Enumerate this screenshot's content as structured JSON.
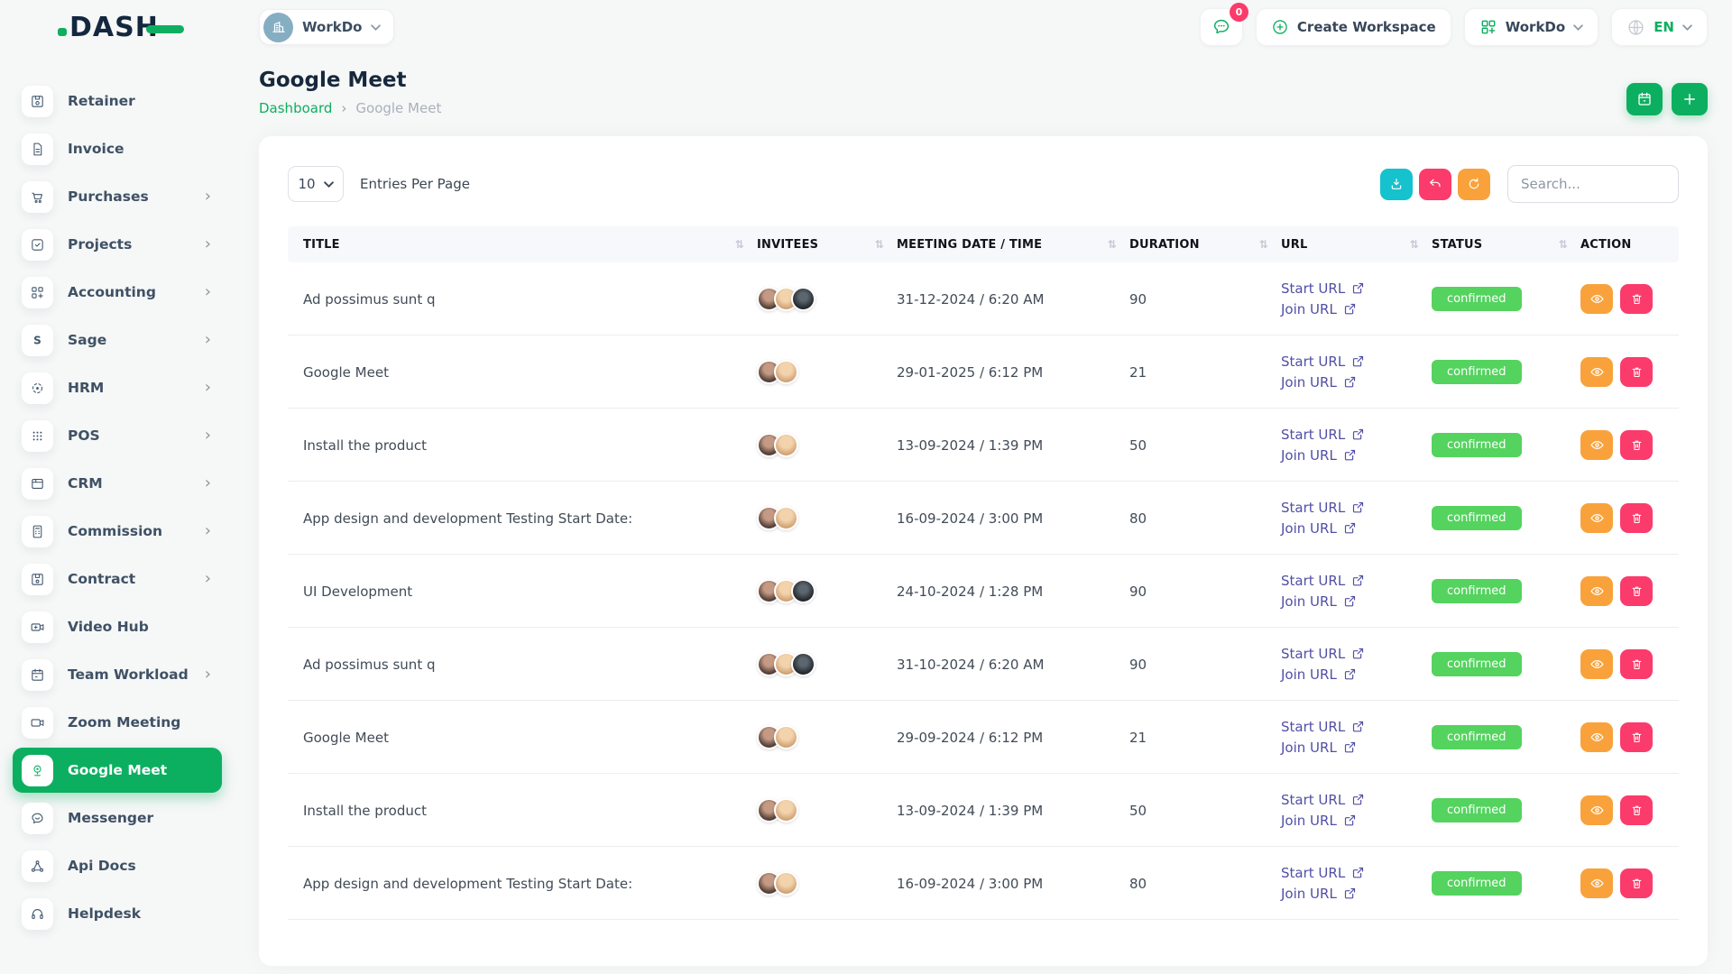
{
  "colors": {
    "theme_green": "#0caf60",
    "badge_green": "#54d35f",
    "teal": "#16c2cd",
    "pink": "#fb3b6b",
    "orange": "#f9a23b",
    "link_indigo": "#514fa5",
    "navy": "#16283c"
  },
  "topbar": {
    "logo_text": "DASH",
    "workspace_switcher_label": "WorkDo",
    "messages_badge_count": "0",
    "create_workspace_label": "Create Workspace",
    "workspace_menu_label": "WorkDo",
    "language_code": "EN"
  },
  "sidebar": {
    "items": [
      {
        "label": "Retainer",
        "icon": "retainer",
        "expandable": false,
        "active": false
      },
      {
        "label": "Invoice",
        "icon": "invoice",
        "expandable": false,
        "active": false
      },
      {
        "label": "Purchases",
        "icon": "purchases",
        "expandable": true,
        "active": false
      },
      {
        "label": "Projects",
        "icon": "projects",
        "expandable": true,
        "active": false
      },
      {
        "label": "Accounting",
        "icon": "accounting",
        "expandable": true,
        "active": false
      },
      {
        "label": "Sage",
        "icon": "sage",
        "expandable": true,
        "active": false
      },
      {
        "label": "HRM",
        "icon": "hrm",
        "expandable": true,
        "active": false
      },
      {
        "label": "POS",
        "icon": "pos",
        "expandable": true,
        "active": false
      },
      {
        "label": "CRM",
        "icon": "crm",
        "expandable": true,
        "active": false
      },
      {
        "label": "Commission",
        "icon": "commission",
        "expandable": true,
        "active": false
      },
      {
        "label": "Contract",
        "icon": "contract",
        "expandable": true,
        "active": false
      },
      {
        "label": "Video Hub",
        "icon": "video-hub",
        "expandable": false,
        "active": false
      },
      {
        "label": "Team Workload",
        "icon": "team-workload",
        "expandable": true,
        "active": false
      },
      {
        "label": "Zoom Meeting",
        "icon": "zoom-meeting",
        "expandable": false,
        "active": false
      },
      {
        "label": "Google Meet",
        "icon": "google-meet",
        "expandable": false,
        "active": true
      },
      {
        "label": "Messenger",
        "icon": "messenger",
        "expandable": false,
        "active": false
      },
      {
        "label": "Api Docs",
        "icon": "api-docs",
        "expandable": false,
        "active": false
      },
      {
        "label": "Helpdesk",
        "icon": "helpdesk",
        "expandable": false,
        "active": false
      }
    ]
  },
  "page": {
    "title": "Google Meet",
    "breadcrumb_root": "Dashboard",
    "breadcrumb_current": "Google Meet"
  },
  "toolbar": {
    "entries_per_page_value": "10",
    "entries_per_page_label": "Entries Per Page",
    "search_placeholder": "Search..."
  },
  "table": {
    "columns": [
      "TITLE",
      "INVITEES",
      "MEETING DATE / TIME",
      "DURATION",
      "URL",
      "STATUS",
      "ACTION"
    ],
    "link_labels": {
      "start": "Start URL",
      "join": "Join URL"
    },
    "rows": [
      {
        "title": "Ad possimus sunt q",
        "invitees_count": 3,
        "datetime": "31-12-2024 / 6:20 AM",
        "duration": "90",
        "status": "confirmed"
      },
      {
        "title": "Google Meet",
        "invitees_count": 2,
        "datetime": "29-01-2025 / 6:12 PM",
        "duration": "21",
        "status": "confirmed"
      },
      {
        "title": "Install the product",
        "invitees_count": 2,
        "datetime": "13-09-2024 / 1:39 PM",
        "duration": "50",
        "status": "confirmed"
      },
      {
        "title": "App design and development Testing Start Date:",
        "invitees_count": 2,
        "datetime": "16-09-2024 / 3:00 PM",
        "duration": "80",
        "status": "confirmed"
      },
      {
        "title": "UI Development",
        "invitees_count": 3,
        "datetime": "24-10-2024 / 1:28 PM",
        "duration": "90",
        "status": "confirmed"
      },
      {
        "title": "Ad possimus sunt q",
        "invitees_count": 3,
        "datetime": "31-10-2024 / 6:20 AM",
        "duration": "90",
        "status": "confirmed"
      },
      {
        "title": "Google Meet",
        "invitees_count": 2,
        "datetime": "29-09-2024 / 6:12 PM",
        "duration": "21",
        "status": "confirmed"
      },
      {
        "title": "Install the product",
        "invitees_count": 2,
        "datetime": "13-09-2024 / 1:39 PM",
        "duration": "50",
        "status": "confirmed"
      },
      {
        "title": "App design and development Testing Start Date:",
        "invitees_count": 2,
        "datetime": "16-09-2024 / 3:00 PM",
        "duration": "80",
        "status": "confirmed"
      }
    ]
  }
}
